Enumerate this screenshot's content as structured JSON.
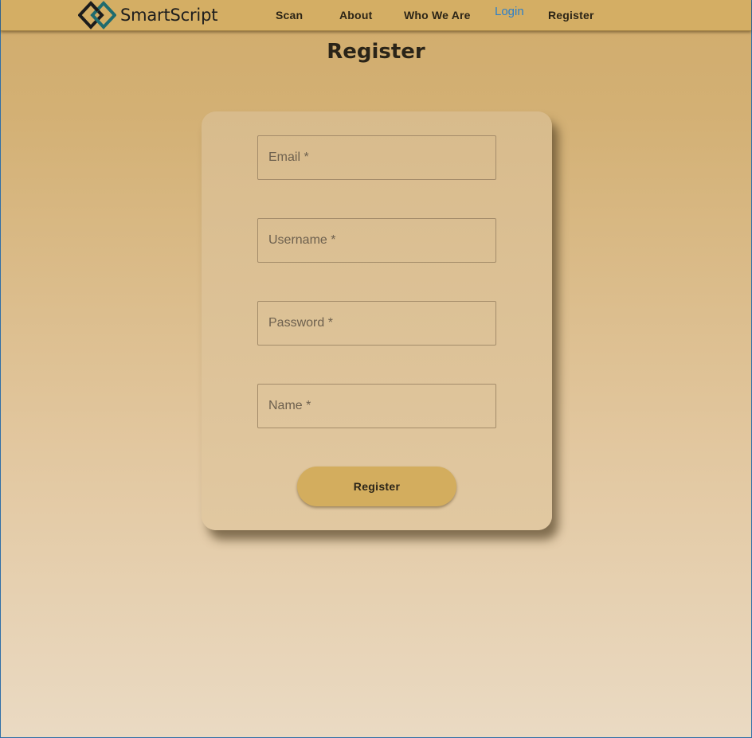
{
  "brand": {
    "name": "SmartScript",
    "logo_icon": "interlocking-diamonds-icon",
    "logo_colors": [
      "#1c1c1c",
      "#1f6b6e"
    ]
  },
  "nav": {
    "items": [
      {
        "label": "Scan"
      },
      {
        "label": "About"
      },
      {
        "label": "Who We Are"
      },
      {
        "label": "Login"
      },
      {
        "label": "Register"
      }
    ]
  },
  "page": {
    "title": "Register"
  },
  "form": {
    "fields": [
      {
        "placeholder": "Email *",
        "value": ""
      },
      {
        "placeholder": "Username *",
        "value": ""
      },
      {
        "placeholder": "Password *",
        "value": ""
      },
      {
        "placeholder": "Name *",
        "value": ""
      }
    ],
    "submit_label": "Register"
  },
  "colors": {
    "navbar": "#d4ae64",
    "button": "#d3ad5e",
    "link": "#2c7fc9"
  }
}
